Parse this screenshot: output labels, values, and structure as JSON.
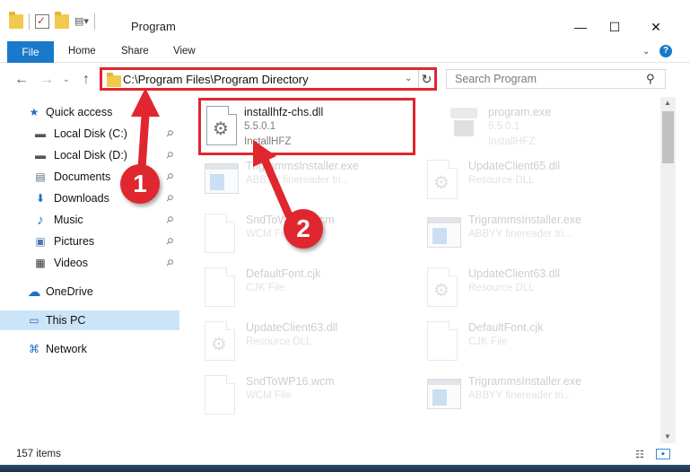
{
  "window": {
    "title": "Program",
    "minimize_glyph": "—",
    "maximize_glyph": "☐",
    "close_glyph": "✕"
  },
  "ribbon": {
    "file": "File",
    "home": "Home",
    "share": "Share",
    "view": "View",
    "help": "?"
  },
  "nav": {
    "back": "←",
    "forward": "→",
    "recent": "⌄",
    "up": "↑",
    "address": "C:\\Program Files\\Program Directory",
    "address_dropdown": "⌄",
    "refresh": "↻",
    "search_placeholder": "Search Program",
    "search_icon": "⚲"
  },
  "sidebar": {
    "items": [
      {
        "label": "Quick access",
        "icon": "star-icon",
        "glyph": "★",
        "pinned": false
      },
      {
        "label": "Local Disk (C:)",
        "icon": "drive-icon",
        "glyph": "▬",
        "pinned": true
      },
      {
        "label": "Local Disk (D:)",
        "icon": "drive-icon",
        "glyph": "▬",
        "pinned": true
      },
      {
        "label": "Documents",
        "icon": "documents-icon",
        "glyph": "▤",
        "pinned": true
      },
      {
        "label": "Downloads",
        "icon": "download-icon",
        "glyph": "⬇",
        "pinned": true
      },
      {
        "label": "Music",
        "icon": "music-icon",
        "glyph": "♪",
        "pinned": true
      },
      {
        "label": "Pictures",
        "icon": "pictures-icon",
        "glyph": "▣",
        "pinned": true
      },
      {
        "label": "Videos",
        "icon": "videos-icon",
        "glyph": "▦",
        "pinned": true
      },
      {
        "label": "OneDrive",
        "icon": "cloud-icon",
        "glyph": "☁",
        "pinned": false
      },
      {
        "label": "This PC",
        "icon": "computer-icon",
        "glyph": "▭",
        "pinned": false,
        "selected": true
      },
      {
        "label": "Network",
        "icon": "network-icon",
        "glyph": "⌘",
        "pinned": false
      }
    ],
    "pin_glyph": "📌"
  },
  "files": [
    {
      "name": "installhfz-chs.dll",
      "line2": "5.5.0.1",
      "line3": "InstallHFZ",
      "icon": "dll-gear-icon",
      "highlighted": true
    },
    {
      "name": "program.exe",
      "line2": "5.5.0.1",
      "line3": "InstallHFZ",
      "icon": "exe-icon"
    },
    {
      "name": "TrigrammsInstaller.exe",
      "line2": "ABBYY finereader tri...",
      "line3": "",
      "icon": "app-window-icon"
    },
    {
      "name": "UpdateClient65.dll",
      "line2": "Resource DLL",
      "line3": "",
      "icon": "dll-gear-icon"
    },
    {
      "name": "SndToWP16.wcm",
      "line2": "WCM File",
      "line3": "",
      "icon": "blank-file-icon"
    },
    {
      "name": "TrigrammsInstaller.exe",
      "line2": "ABBYY finereader tri...",
      "line3": "",
      "icon": "app-window-icon"
    },
    {
      "name": "DefaultFont.cjk",
      "line2": "CJK File",
      "line3": "",
      "icon": "blank-file-icon"
    },
    {
      "name": "UpdateClient63.dll",
      "line2": "Resource DLL",
      "line3": "",
      "icon": "dll-gear-icon"
    },
    {
      "name": "UpdateClient63.dll",
      "line2": "Resource DLL",
      "line3": "",
      "icon": "dll-gear-icon"
    },
    {
      "name": "DefaultFont.cjk",
      "line2": "CJK File",
      "line3": "",
      "icon": "blank-file-icon"
    },
    {
      "name": "SndToWP16.wcm",
      "line2": "WCM File",
      "line3": "",
      "icon": "blank-file-icon"
    },
    {
      "name": "TrigrammsInstaller.exe",
      "line2": "ABBYY finereader tri...",
      "line3": "",
      "icon": "app-window-icon"
    }
  ],
  "status": {
    "item_count": "157 items"
  },
  "annotations": {
    "callout1": "1",
    "callout2": "2",
    "accent_color": "#e0262e"
  }
}
